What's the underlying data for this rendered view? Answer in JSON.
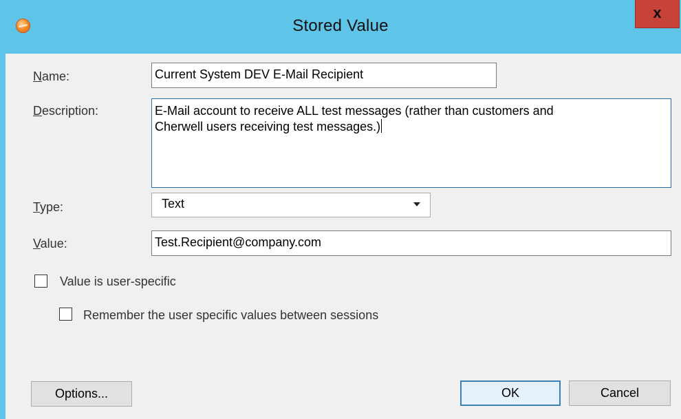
{
  "window": {
    "title": "Stored Value",
    "close_label": "x",
    "app_icon": "cherwell-app-icon"
  },
  "form": {
    "name": {
      "label": "Name:",
      "accelerator": "N",
      "label_rest": "ame:",
      "value": "Current System DEV E-Mail Recipient"
    },
    "description": {
      "label": "Description:",
      "accelerator": "D",
      "label_rest": "escription:",
      "value_line1": "E-Mail account to receive ALL test messages (rather than customers and",
      "value_line2": "Cherwell users receiving test messages.)"
    },
    "type": {
      "label": "Type:",
      "accelerator": "T",
      "label_rest": "ype:",
      "selected": "Text"
    },
    "value": {
      "label": "Value:",
      "accelerator": "V",
      "label_rest": "alue:",
      "value": "Test.Recipient@company.com"
    }
  },
  "options": {
    "user_specific": {
      "label": "Value is user-specific",
      "checked": false
    },
    "remember": {
      "label": "Remember the user specific values between sessions",
      "checked": false
    }
  },
  "buttons": {
    "options": "Options...",
    "ok": "OK",
    "cancel": "Cancel"
  }
}
